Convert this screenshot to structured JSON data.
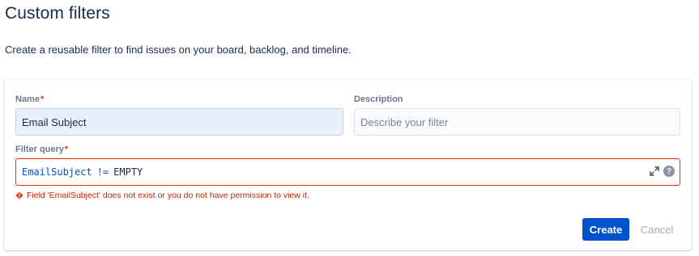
{
  "header": {
    "title": "Custom filters",
    "description": "Create a reusable filter to find issues on your board, backlog, and timeline."
  },
  "form": {
    "name_label": "Name",
    "required_mark": "*",
    "name_value": "Email Subject",
    "description_label": "Description",
    "description_placeholder": "Describe your filter",
    "query_label": "Filter query",
    "query": {
      "field": "EmailSubject",
      "operator": "!=",
      "value": "EMPTY"
    },
    "error_message": "Field 'EmailSubject' does not exist or you do not have permission to view it.",
    "create_label": "Create",
    "cancel_label": "Cancel"
  },
  "icons": {
    "expand": "expand-icon",
    "help": "help-icon",
    "error": "error-icon"
  },
  "colors": {
    "primary": "#0052cc",
    "error": "#de350b",
    "name_field_bg": "#e9f0fc"
  }
}
